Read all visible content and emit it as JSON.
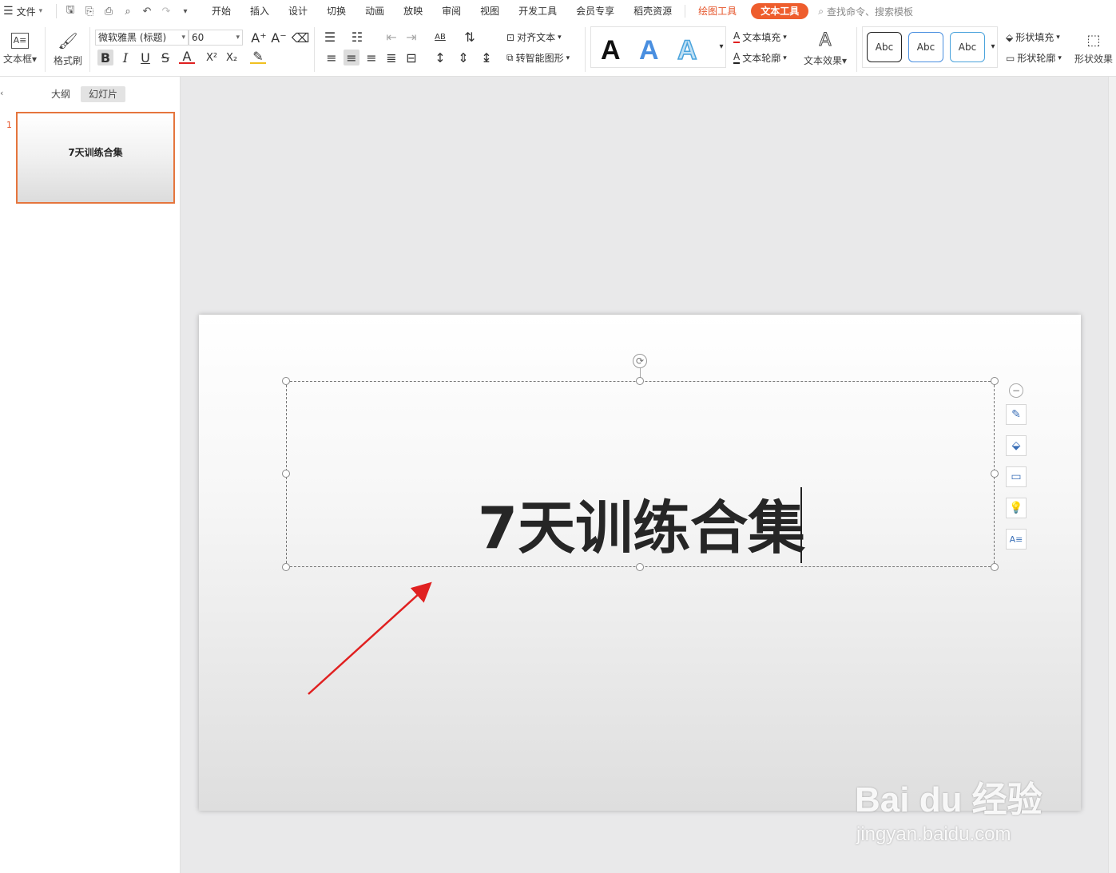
{
  "menu": {
    "file_label": "文件",
    "tabs": [
      "开始",
      "插入",
      "设计",
      "切换",
      "动画",
      "放映",
      "审阅",
      "视图",
      "开发工具",
      "会员专享",
      "稻壳资源"
    ],
    "drawing_tools": "绘图工具",
    "text_tools": "文本工具",
    "search_placeholder": "查找命令、搜索模板"
  },
  "ribbon": {
    "textbox_label": "文本框",
    "format_painter_label": "格式刷",
    "font_name": "微软雅黑 (标题)",
    "font_size": "60",
    "align_text_label": "对齐文本",
    "smartart_label": "转智能图形",
    "text_fill_label": "文本填充",
    "text_outline_label": "文本轮廓",
    "text_effect_label": "文本效果",
    "shape_fill_label": "形状填充",
    "shape_outline_label": "形状轮廓",
    "shape_effect_label": "形状效果",
    "style_preview": "Abc",
    "wordart_letter": "A",
    "bold": "B",
    "italic": "I",
    "underline": "U",
    "strike": "S",
    "font_color": "A",
    "superscript": "X²",
    "subscript": "X₂"
  },
  "left_panel": {
    "tab_outline": "大纲",
    "tab_slides": "幻灯片",
    "slides": [
      {
        "number": "1",
        "title": "7天训练合集"
      }
    ]
  },
  "slide": {
    "title": "7天训练合集"
  },
  "watermark": {
    "main": "Bai du 经验",
    "sub": "jingyan.baidu.com"
  },
  "colors": {
    "accent": "#ee5d2d",
    "selection_border": "#e5753d",
    "arrow": "#e02020"
  }
}
